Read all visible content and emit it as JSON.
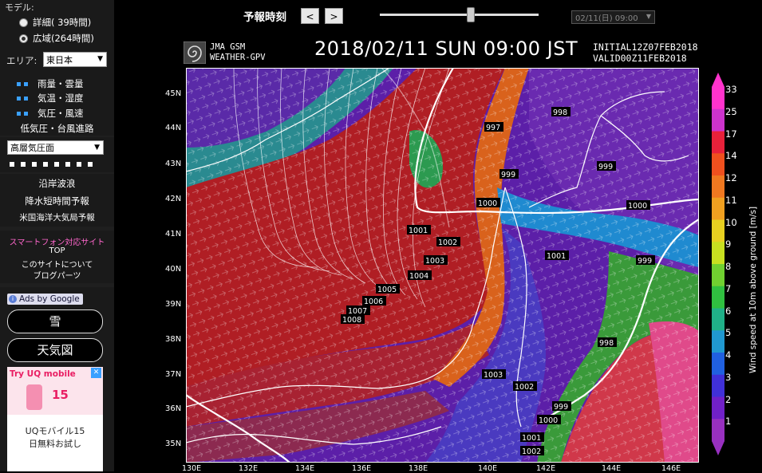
{
  "sidebar": {
    "model_label": "モデル:",
    "model_options": [
      {
        "label": "詳細( 39時間)",
        "selected": false
      },
      {
        "label": "広域(264時間)",
        "selected": true
      }
    ],
    "area_label": "エリア:",
    "area_value": "東日本",
    "menu_items": [
      "雨量・雲量",
      "気温・湿度",
      "気圧・風速"
    ],
    "typhoon_link": "低気圧・台風進路",
    "upper_select": "高層気圧面",
    "links": [
      "沿岸波浪",
      "降水短時間予報",
      "米国海洋大気局予報"
    ],
    "smartphone_link": "スマートフォン対応サイト",
    "top_link": "TOP",
    "about_link": "このサイトについて",
    "blog_link": "ブログパーツ",
    "ads_label": "Ads by Google",
    "ad_buttons": [
      "雪",
      "天気図"
    ],
    "ad": {
      "brand": "Try UQ mobile",
      "days": "15",
      "title": "UQモバイル15",
      "subtitle": "日無料お試し",
      "close": "✕"
    }
  },
  "toolbar": {
    "forecast_time_label": "予報時刻",
    "prev_label": "<",
    "next_label": ">",
    "time_select": "02/11(日) 09:00"
  },
  "map": {
    "logo_line1": "JMA GSM",
    "logo_line2": "WEATHER-GPV",
    "datetime": "2018/02/11 SUN 09:00 JST",
    "initial": "INITIAL12Z07FEB2018",
    "valid": "VALID00Z11FEB2018",
    "lat_labels": [
      "45N",
      "44N",
      "43N",
      "42N",
      "41N",
      "40N",
      "39N",
      "38N",
      "37N",
      "36N",
      "35N"
    ],
    "lon_labels": [
      "130E",
      "132E",
      "134E",
      "136E",
      "138E",
      "140E",
      "142E",
      "144E",
      "146E"
    ],
    "isobar_labels": [
      "997",
      "998",
      "999",
      "999",
      "1000",
      "1000",
      "1001",
      "1002",
      "1003",
      "1004",
      "1005",
      "1006",
      "1007",
      "1008",
      "1001",
      "999",
      "998",
      "1003",
      "1002",
      "999",
      "1000",
      "1001",
      "1002"
    ],
    "colorbar_title": "Wind speed at 10m above ground [m/s]",
    "colorbar_ticks": [
      "33",
      "25",
      "17",
      "14",
      "12",
      "11",
      "10",
      "9",
      "8",
      "7",
      "6",
      "5",
      "4",
      "3",
      "2",
      "1"
    ],
    "colorbar_colors": [
      "#ff33cc",
      "#cc33cc",
      "#e8213a",
      "#f0501e",
      "#f07820",
      "#f0a020",
      "#e8d020",
      "#c8e020",
      "#70d030",
      "#30c040",
      "#20b088",
      "#2098d0",
      "#2060e0",
      "#4030d8",
      "#7020c8",
      "#9830c0"
    ]
  }
}
